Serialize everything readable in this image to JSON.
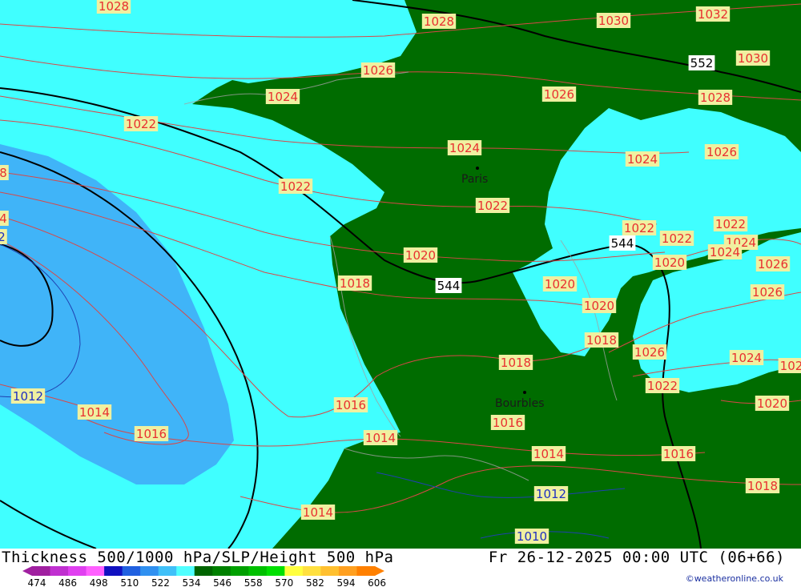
{
  "title": "Thickness 500/1000 hPa/SLP/Height 500 hPa",
  "valid_time": "Fr 26-12-2025 00:00 UTC (06+66)",
  "credit": "©weatheronline.co.uk",
  "cities": [
    {
      "name": "Paris"
    },
    {
      "name": "Bourbles"
    }
  ],
  "isobar_labels": [
    {
      "text": "1028",
      "color": "#e83030"
    },
    {
      "text": "1028",
      "color": "#e83030"
    },
    {
      "text": "1030",
      "color": "#e83030"
    },
    {
      "text": "1032",
      "color": "#e83030"
    },
    {
      "text": "1030",
      "color": "#e83030"
    },
    {
      "text": "1026",
      "color": "#e83030"
    },
    {
      "text": "1026",
      "color": "#e83030"
    },
    {
      "text": "1028",
      "color": "#e83030"
    },
    {
      "text": "1024",
      "color": "#e83030"
    },
    {
      "text": "1022",
      "color": "#e83030"
    },
    {
      "text": "1024",
      "color": "#e83030"
    },
    {
      "text": "1024",
      "color": "#e83030"
    },
    {
      "text": "1026",
      "color": "#e83030"
    },
    {
      "text": "1022",
      "color": "#e83030"
    },
    {
      "text": "1022",
      "color": "#e83030"
    },
    {
      "text": "1022",
      "color": "#e83030"
    },
    {
      "text": "1022",
      "color": "#e83030"
    },
    {
      "text": "1024",
      "color": "#e83030"
    },
    {
      "text": "1022",
      "color": "#e83030"
    },
    {
      "text": "1024",
      "color": "#e83030"
    },
    {
      "text": "1026",
      "color": "#e83030"
    },
    {
      "text": "1020",
      "color": "#e83030"
    },
    {
      "text": "1020",
      "color": "#e83030"
    },
    {
      "text": "1026",
      "color": "#e83030"
    },
    {
      "text": "1018",
      "color": "#e83030"
    },
    {
      "text": "1020",
      "color": "#e83030"
    },
    {
      "text": "1020",
      "color": "#e83030"
    },
    {
      "text": "1018",
      "color": "#e83030"
    },
    {
      "text": "1026",
      "color": "#e83030"
    },
    {
      "text": "1018",
      "color": "#e83030"
    },
    {
      "text": "1024",
      "color": "#e83030"
    },
    {
      "text": "102",
      "color": "#e83030"
    },
    {
      "text": "1022",
      "color": "#e83030"
    },
    {
      "text": "1012",
      "color": "#2030c0"
    },
    {
      "text": "1014",
      "color": "#e83030"
    },
    {
      "text": "1016",
      "color": "#e83030"
    },
    {
      "text": "1016",
      "color": "#e83030"
    },
    {
      "text": "1016",
      "color": "#e83030"
    },
    {
      "text": "1020",
      "color": "#e83030"
    },
    {
      "text": "1014",
      "color": "#e83030"
    },
    {
      "text": "1014",
      "color": "#e83030"
    },
    {
      "text": "1016",
      "color": "#e83030"
    },
    {
      "text": "1018",
      "color": "#e83030"
    },
    {
      "text": "1012",
      "color": "#2030c0"
    },
    {
      "text": "1014",
      "color": "#e83030"
    },
    {
      "text": "1010",
      "color": "#2030c0"
    },
    {
      "text": "8",
      "color": "#e83030"
    },
    {
      "text": "4",
      "color": "#e83030"
    },
    {
      "text": "2",
      "color": "#2030c0"
    }
  ],
  "height_labels": [
    {
      "text": "552"
    },
    {
      "text": "544"
    },
    {
      "text": "544"
    }
  ],
  "legend": {
    "values": [
      "474",
      "486",
      "498",
      "510",
      "522",
      "534",
      "546",
      "558",
      "570",
      "582",
      "594",
      "606"
    ],
    "colors": [
      "#a020a0",
      "#c030d0",
      "#e040f0",
      "#ff60ff",
      "#1010c0",
      "#2060e0",
      "#3090f0",
      "#40c0f8",
      "#50ffff",
      "#006400",
      "#008000",
      "#00a000",
      "#00c000",
      "#00e000",
      "#ffff40",
      "#ffe040",
      "#ffc030",
      "#ffa020",
      "#ff8000"
    ]
  },
  "colors": {
    "land_green": "#006c00",
    "thickness_cyan": "#40ffff",
    "thickness_blue": "#40b4f8",
    "isobar_red": "#e83030",
    "label_bg": "#f0f0a0"
  }
}
